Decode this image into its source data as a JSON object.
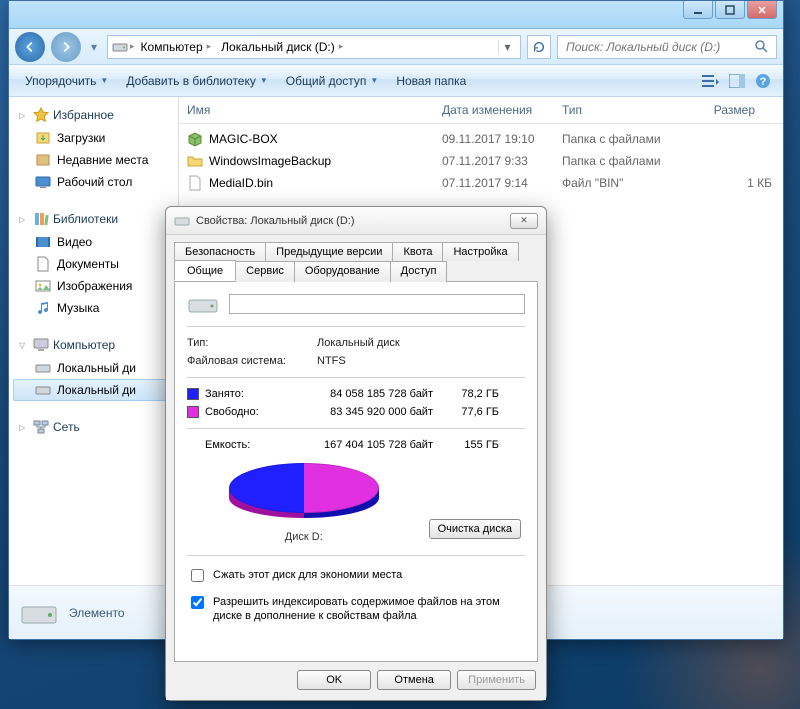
{
  "explorer": {
    "breadcrumb": [
      {
        "label": "Компьютер"
      },
      {
        "label": "Локальный диск (D:)"
      }
    ],
    "search_placeholder": "Поиск: Локальный диск (D:)",
    "toolbar": {
      "organize": "Упорядочить",
      "add_library": "Добавить в библиотеку",
      "share": "Общий доступ",
      "new_folder": "Новая папка"
    },
    "columns": {
      "name": "Имя",
      "date": "Дата изменения",
      "type": "Тип",
      "size": "Размер"
    },
    "files": [
      {
        "name": "MAGIC-BOX",
        "date": "09.11.2017 19:10",
        "type": "Папка с файлами",
        "size": "",
        "icon": "box"
      },
      {
        "name": "WindowsImageBackup",
        "date": "07.11.2017 9:33",
        "type": "Папка с файлами",
        "size": "",
        "icon": "folder"
      },
      {
        "name": "MediaID.bin",
        "date": "07.11.2017 9:14",
        "type": "Файл \"BIN\"",
        "size": "1 КБ",
        "icon": "file"
      }
    ],
    "details_label": "Элементо",
    "sidebar": {
      "favorites": {
        "label": "Избранное",
        "items": [
          {
            "label": "Загрузки",
            "key": "downloads"
          },
          {
            "label": "Недавние места",
            "key": "recent"
          },
          {
            "label": "Рабочий стол",
            "key": "desktop"
          }
        ]
      },
      "libraries": {
        "label": "Библиотеки",
        "items": [
          {
            "label": "Видео",
            "key": "video"
          },
          {
            "label": "Документы",
            "key": "docs"
          },
          {
            "label": "Изображения",
            "key": "images"
          },
          {
            "label": "Музыка",
            "key": "music"
          }
        ]
      },
      "computer": {
        "label": "Компьютер",
        "items": [
          {
            "label": "Локальный ди",
            "key": "disk-c"
          },
          {
            "label": "Локальный ди",
            "key": "disk-d",
            "selected": true
          }
        ]
      },
      "network": {
        "label": "Сеть",
        "items": []
      }
    }
  },
  "dialog": {
    "title": "Свойства: Локальный диск (D:)",
    "tabs_row1": [
      "Безопасность",
      "Предыдущие версии",
      "Квота",
      "Настройка"
    ],
    "tabs_row2": [
      "Общие",
      "Сервис",
      "Оборудование",
      "Доступ"
    ],
    "active_tab": "Общие",
    "type_label": "Тип:",
    "type_value": "Локальный диск",
    "fs_label": "Файловая система:",
    "fs_value": "NTFS",
    "used_label": "Занято:",
    "used_bytes": "84 058 185 728 байт",
    "used_gb": "78,2 ГБ",
    "free_label": "Свободно:",
    "free_bytes": "83 345 920 000 байт",
    "free_gb": "77,6 ГБ",
    "cap_label": "Емкость:",
    "cap_bytes": "167 404 105 728 байт",
    "cap_gb": "155 ГБ",
    "disk_name": "Диск D:",
    "cleanup": "Очистка диска",
    "compress": "Сжать этот диск для экономии места",
    "index": "Разрешить индексировать содержимое файлов на этом диске в дополнение к свойствам файла",
    "ok": "OK",
    "cancel": "Отмена",
    "apply": "Применить",
    "drive_name_value": ""
  }
}
